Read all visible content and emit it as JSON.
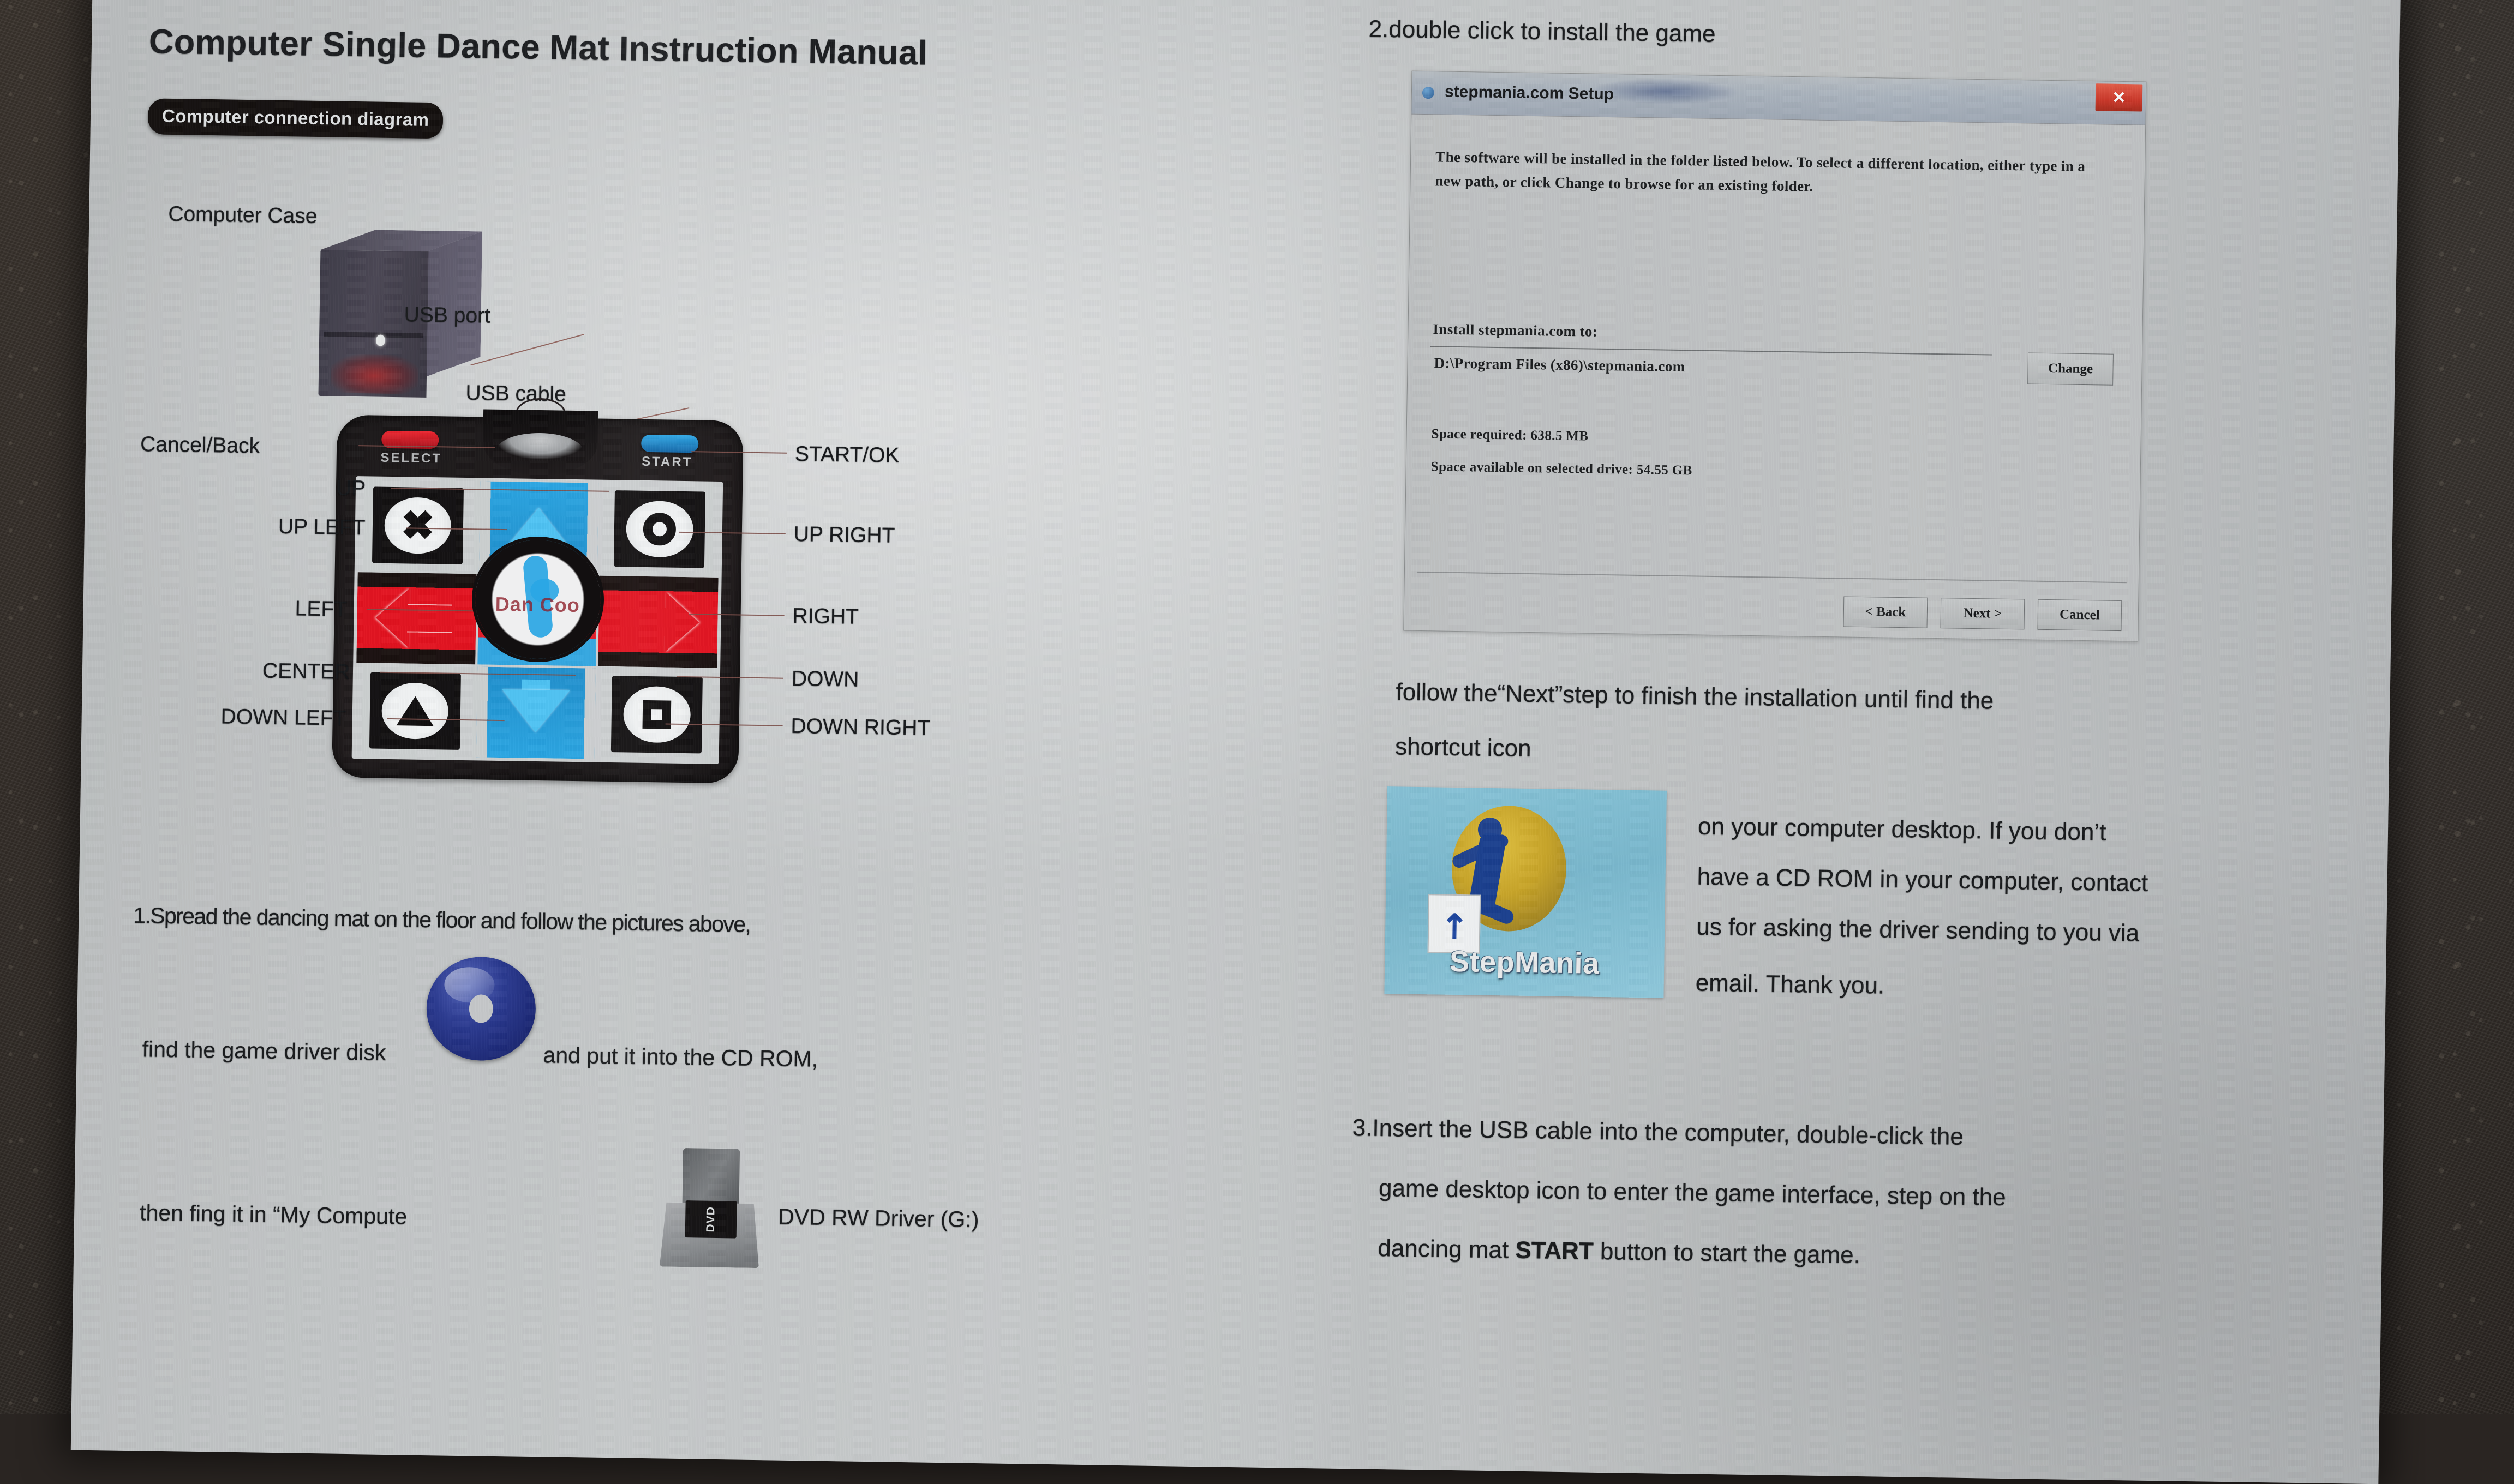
{
  "document": {
    "title": "Computer Single Dance Mat Instruction Manual",
    "section_badge": "Computer connection diagram"
  },
  "diagram": {
    "computer_case_label": "Computer Case",
    "usb_port_label": "USB port",
    "usb_cable_label": "USB cable",
    "mat": {
      "select_button": "SELECT",
      "start_button": "START",
      "center_brand": "Dan Coo",
      "labels_left": [
        "Cancel/Back",
        "UP",
        "UP LEFT",
        "LEFT",
        "CENTER",
        "DOWN LEFT"
      ],
      "labels_right": [
        "START/OK",
        "UP RIGHT",
        "RIGHT",
        "DOWN",
        "DOWN RIGHT"
      ]
    }
  },
  "steps": {
    "step1_line1": "1.Spread the dancing mat on the floor and follow the pictures above,",
    "step1_line2_before": "find the game driver disk",
    "step1_line2_after": "and put it into the CD ROM,",
    "step1_line3_before": "then fing it in “My Compute",
    "step1_line3_after": "DVD RW Driver  (G:)",
    "dvd_icon_text": "DVD",
    "step2_heading": "2.double click to install the game",
    "follow_line1": "follow the“Next”step to finish the installation until find the",
    "follow_line2": "shortcut  icon",
    "right_para_line1": "on your  computer  desktop. If you don’t",
    "right_para_line2": "have  a CD ROM in your computer, contact",
    "right_para_line3": "us for  asking the driver  sending to you via",
    "right_para_line4": "email. Thank you.",
    "step3_line1": "3.Insert the USB cable into the computer, double-click the",
    "step3_line2": "game desktop  icon to enter the game  interface, step on the",
    "step3_line3_a": "dancing mat ",
    "step3_line3_b": "START",
    "step3_line3_c": " button  to start the game."
  },
  "desktop_icon": {
    "label": "StepMania"
  },
  "setup_dialog": {
    "title": "stepmania.com Setup",
    "close_label": "✕",
    "paragraph": "The software will be installed in the folder listed below. To select a different location, either type in a new path, or click Change to browse for an existing folder.",
    "install_label": "Install stepmania.com to:",
    "install_path": "D:\\Program Files (x86)\\stepmania.com",
    "change_button": "Change",
    "space_required": "Space required: 638.5 MB",
    "space_available": "Space available on selected drive: 54.55 GB",
    "buttons": {
      "back": "< Back",
      "next": "Next >",
      "cancel": "Cancel"
    }
  },
  "colors": {
    "paper": "#c3c6c7",
    "carpet": "#2d2824",
    "mat_red": "#e4121f",
    "mat_blue": "#2aa6e4",
    "mat_black": "#17141a",
    "dialog_face": "#c0c3c4",
    "close_red": "#cf2d1d",
    "icon_teal": "#88c4d8"
  }
}
